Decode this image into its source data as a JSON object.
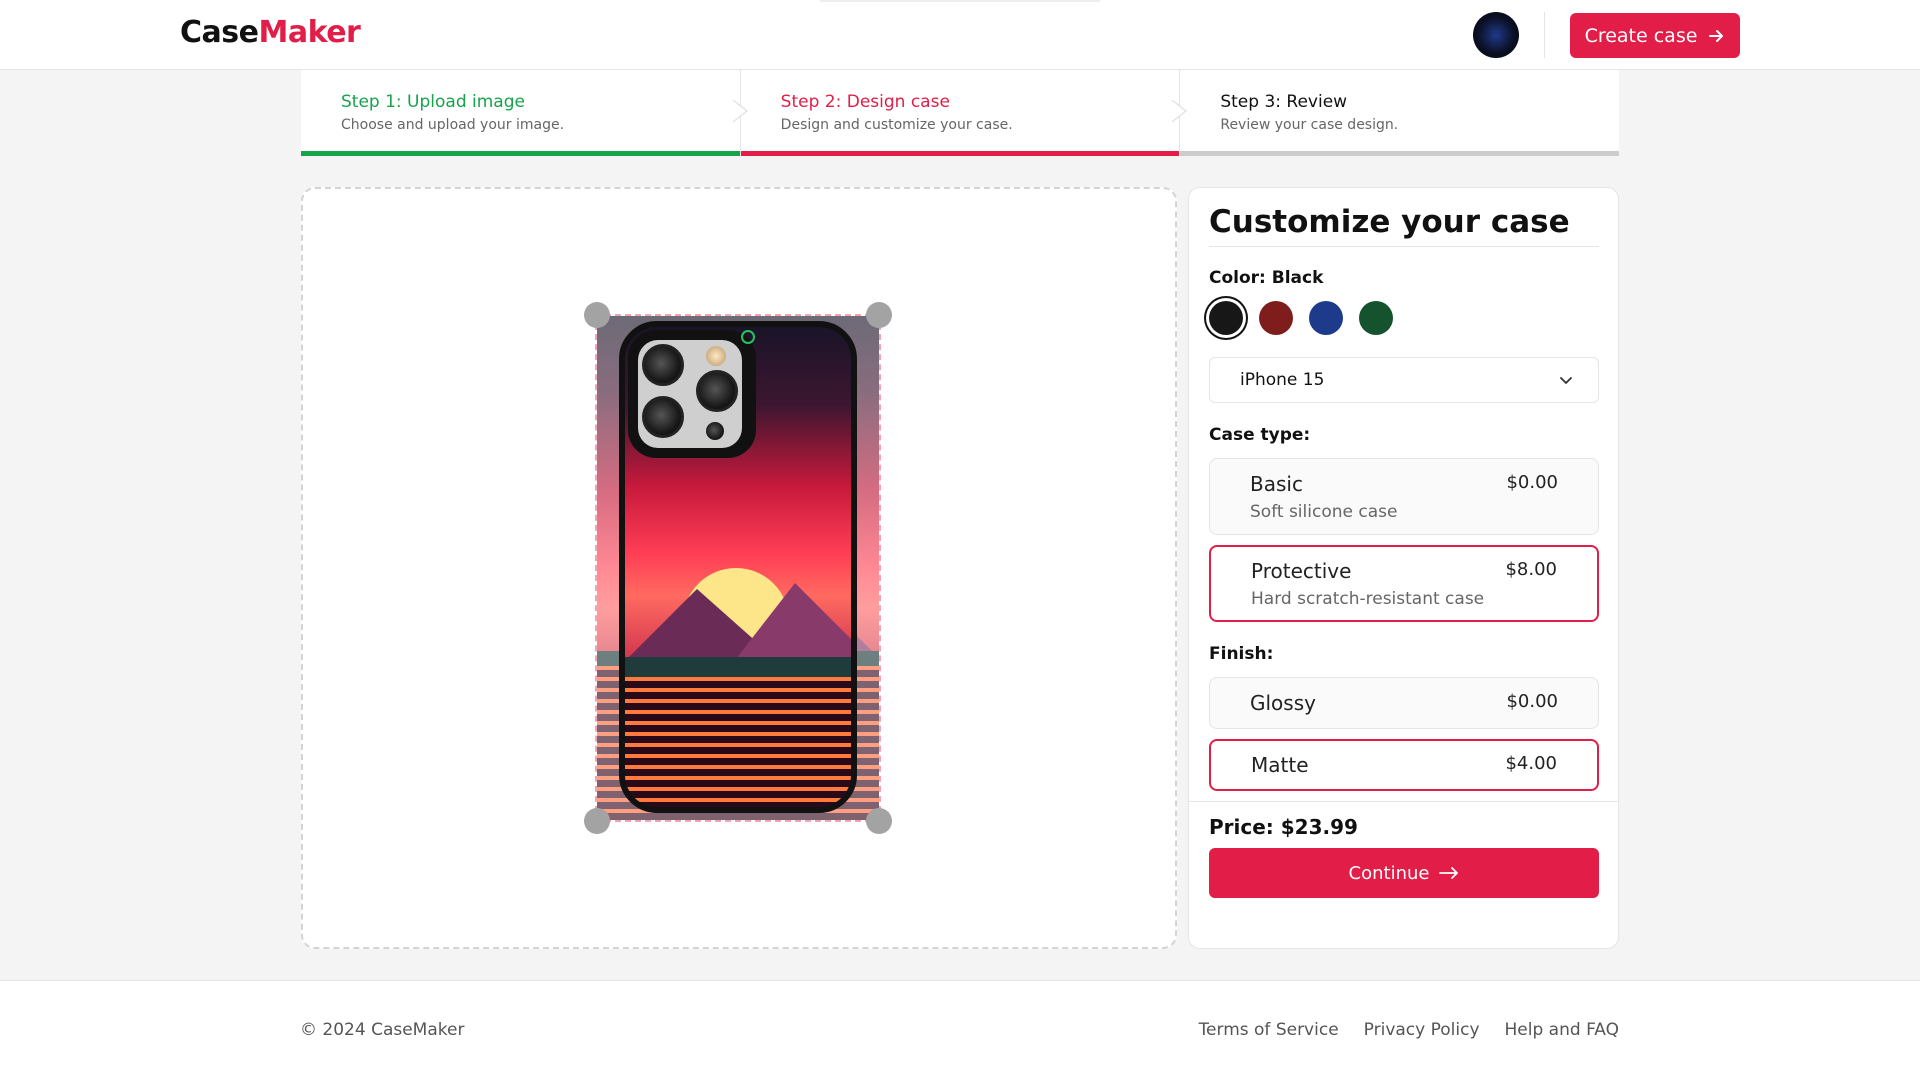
{
  "header": {
    "logo_part1": "Case",
    "logo_part2": "Maker",
    "create_case_label": "Create case"
  },
  "steps": [
    {
      "title": "Step 1: Upload image",
      "subtitle": "Choose and upload your image.",
      "state": "complete",
      "color": "#16a34a"
    },
    {
      "title": "Step 2: Design case",
      "subtitle": "Design and customize your case.",
      "state": "current",
      "color": "#e11d48"
    },
    {
      "title": "Step 3: Review",
      "subtitle": "Review your case design.",
      "state": "upcoming",
      "color": "#cccccc"
    }
  ],
  "panel": {
    "title": "Customize your case",
    "color_label": "Color: Black",
    "colors": [
      {
        "name": "Black",
        "hex": "#171717",
        "selected": true
      },
      {
        "name": "Red",
        "hex": "#7f1d1d",
        "selected": false
      },
      {
        "name": "Blue",
        "hex": "#1e3a8a",
        "selected": false
      },
      {
        "name": "Green",
        "hex": "#14532d",
        "selected": false
      }
    ],
    "model_value": "iPhone 15",
    "case_type_label": "Case type:",
    "case_types": [
      {
        "name": "Basic",
        "description": "Soft silicone case",
        "price": "$0.00",
        "selected": false
      },
      {
        "name": "Protective",
        "description": "Hard scratch-resistant case",
        "price": "$8.00",
        "selected": true
      }
    ],
    "finish_label": "Finish:",
    "finishes": [
      {
        "name": "Glossy",
        "price": "$0.00",
        "selected": false
      },
      {
        "name": "Matte",
        "price": "$4.00",
        "selected": true
      }
    ],
    "price_text": "Price: $23.99",
    "continue_label": "Continue"
  },
  "footer": {
    "copyright": "© 2024 CaseMaker",
    "links": [
      "Terms of Service",
      "Privacy Policy",
      "Help and FAQ"
    ]
  },
  "accent_color": "#e11d48"
}
